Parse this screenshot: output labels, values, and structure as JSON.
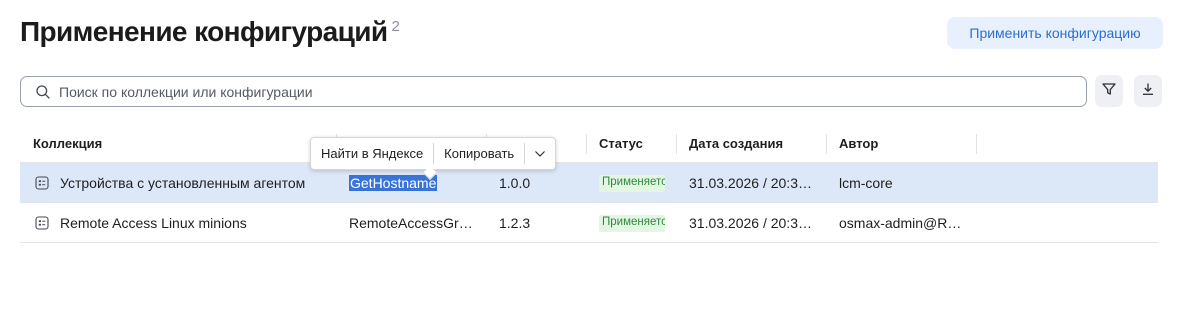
{
  "header": {
    "title": "Применение конфигураций",
    "count": "2",
    "apply_button": "Применить конфигурацию"
  },
  "search": {
    "placeholder": "Поиск по коллекции или конфигурации",
    "value": ""
  },
  "toolbar": {
    "filter_icon": "filter-icon",
    "download_icon": "download-icon"
  },
  "table": {
    "columns": [
      "Коллекция",
      "",
      "",
      "Статус",
      "Дата создания",
      "Автор"
    ],
    "rows": [
      {
        "collection": "Устройства с установленным агентом",
        "configuration": "GetHostname",
        "version": "1.0.0",
        "status": "Применяется",
        "created": "31.03.2026 / 20:3…",
        "author": "lcm-core",
        "selected": true
      },
      {
        "collection": "Remote Access Linux minions",
        "configuration": "RemoteAccessGr…",
        "version": "1.2.3",
        "status": "Применяется",
        "created": "31.03.2026 / 20:3…",
        "author": "osmax-admin@R…",
        "selected": false
      }
    ]
  },
  "context_popup": {
    "search_label": "Найти в Яндексе",
    "copy_label": "Копировать",
    "more_icon": "chevron-down-icon"
  },
  "colors": {
    "accent": "#2a6ed3",
    "selected_row": "#dce7f8",
    "status_bg": "#e3f6e4",
    "status_text": "#2f8a3c",
    "text_selection": "#3874d8"
  }
}
